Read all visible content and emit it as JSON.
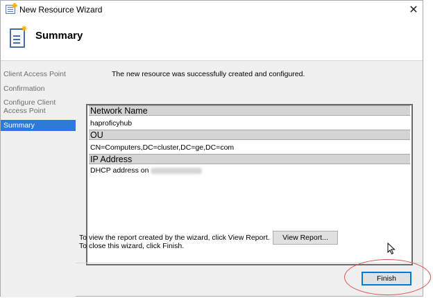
{
  "window": {
    "title": "New Resource Wizard",
    "close_glyph": "✕"
  },
  "header": {
    "title": "Summary",
    "icon": "wizard-page-icon"
  },
  "sidebar": {
    "items": [
      {
        "label": "Client Access Point",
        "active": false
      },
      {
        "label": "Confirmation",
        "active": false
      },
      {
        "label": "Configure Client Access Point",
        "active": false
      },
      {
        "label": "Summary",
        "active": true
      }
    ]
  },
  "main": {
    "status_message": "The new resource was successfully created and configured.",
    "report": {
      "sections": [
        {
          "heading": "Network Name",
          "value": "haproficyhub"
        },
        {
          "heading": "OU",
          "value": "CN=Computers,DC=cluster,DC=ge,DC=com"
        },
        {
          "heading": "IP Address",
          "value": "DHCP address on",
          "value_redacted": true
        }
      ]
    },
    "help_lines": [
      "To view the report created by the wizard, click View Report.",
      "To close this wizard, click Finish."
    ]
  },
  "buttons": {
    "view_report": "View Report...",
    "finish": "Finish"
  },
  "colors": {
    "selection": "#2f7ad6",
    "highlight_annotation": "#e05252",
    "section_header": "#d4d4d4"
  }
}
